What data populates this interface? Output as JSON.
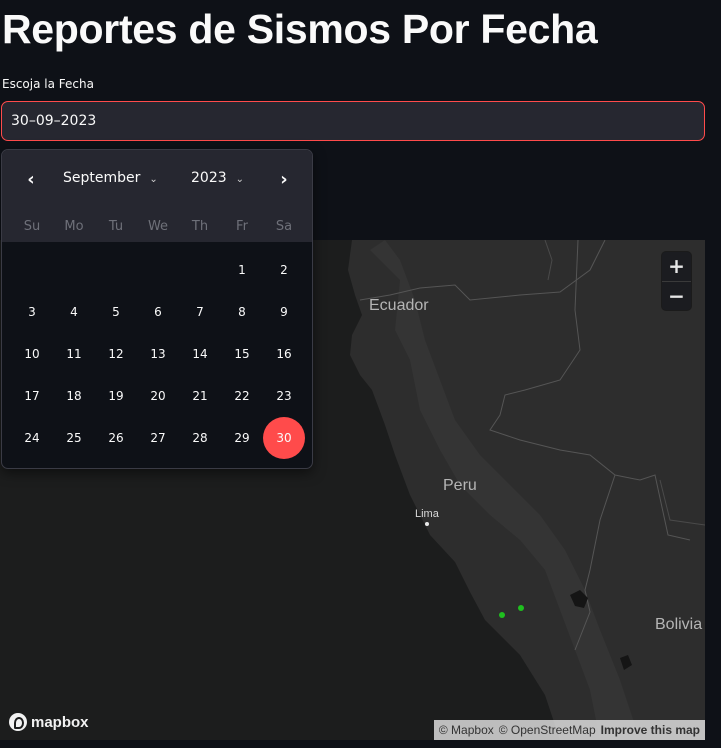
{
  "page": {
    "title": "Reportes de Sismos Por Fecha",
    "date_label": "Escoja la Fecha",
    "date_value": "30–09–2023"
  },
  "calendar": {
    "month": "September",
    "year": "2023",
    "weekdays": [
      "Su",
      "Mo",
      "Tu",
      "We",
      "Th",
      "Fr",
      "Sa"
    ],
    "leading_blanks": 5,
    "days": [
      "1",
      "2",
      "3",
      "4",
      "5",
      "6",
      "7",
      "8",
      "9",
      "10",
      "11",
      "12",
      "13",
      "14",
      "15",
      "16",
      "17",
      "18",
      "19",
      "20",
      "21",
      "22",
      "23",
      "24",
      "25",
      "26",
      "27",
      "28",
      "29",
      "30"
    ],
    "selected_day": "30",
    "accent_color": "#ff4b4b"
  },
  "map": {
    "labels": {
      "ecuador": "Ecuador",
      "peru": "Peru",
      "bolivia": "Bolivia",
      "lima": "Lima"
    },
    "zoom_in": "+",
    "zoom_out": "−",
    "logo": "mapbox",
    "attribution": [
      "© Mapbox",
      "© OpenStreetMap",
      "Improve this map"
    ],
    "marker_color": "#1fbf1f"
  }
}
